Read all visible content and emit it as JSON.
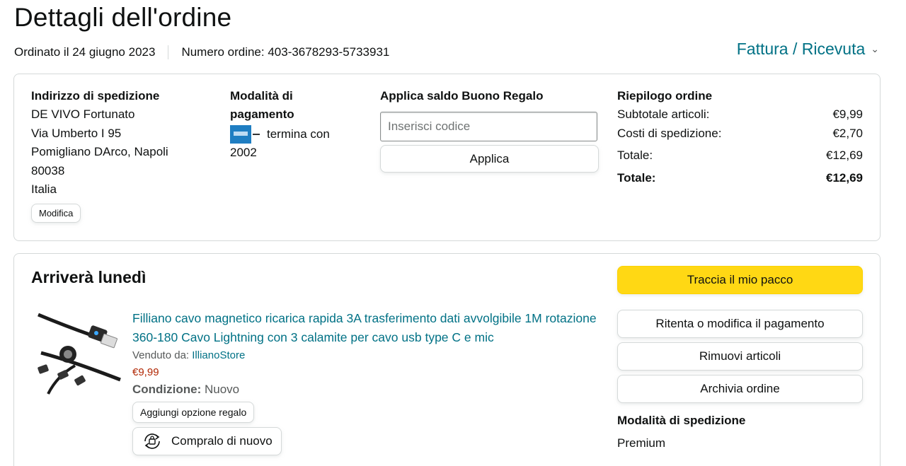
{
  "page": {
    "title": "Dettagli dell'ordine",
    "order_date": "Ordinato il 24 giugno 2023",
    "order_number": "Numero ordine: 403-3678293-5733931",
    "invoice_link": "Fattura / Ricevuta"
  },
  "shipping_address": {
    "title": "Indirizzo di spedizione",
    "name": "DE VIVO Fortunato",
    "street": "Via Umberto I 95",
    "city": "Pomigliano DArco, Napoli",
    "zip": "80038",
    "country": "Italia",
    "edit_label": "Modifica"
  },
  "payment": {
    "title": "Modalità di pagamento",
    "card_text": "termina con",
    "card_last": "2002",
    "card_icon": "amex-card-icon"
  },
  "gift": {
    "title": "Applica saldo Buono Regalo",
    "placeholder": "Inserisci codice",
    "apply_label": "Applica"
  },
  "summary": {
    "title": "Riepilogo ordine",
    "rows": [
      {
        "label": "Subtotale articoli:",
        "value": "€9,99"
      },
      {
        "label": "Costi di spedizione:",
        "value": "€2,70"
      },
      {
        "label": "Totale:",
        "value": "€12,69"
      },
      {
        "label": "Totale:",
        "value": "€12,69"
      }
    ]
  },
  "shipment": {
    "arrival": "Arriverà lunedì",
    "product_title": "Filliano cavo magnetico ricarica rapida 3A trasferimento dati avvolgibile 1M rotazione 360-180 Cavo Lightning con 3 calamite per cavo usb type C e mic",
    "sold_by_label": "Venduto da:",
    "seller": "IllianoStore",
    "price": "€9,99",
    "condition_label": "Condizione:",
    "condition_value": "Nuovo",
    "gift_option_label": "Aggiungi opzione regalo",
    "buy_again_label": "Compralo di nuovo"
  },
  "actions": {
    "track": "Traccia il mio pacco",
    "retry_payment": "Ritenta o modifica il pagamento",
    "remove_items": "Rimuovi articoli",
    "archive": "Archivia ordine",
    "shipping_method_title": "Modalità di spedizione",
    "shipping_method_value": "Premium"
  },
  "colors": {
    "link": "#007185",
    "price": "#b12704",
    "primary_button": "#ffd814",
    "border": "#d5d9d9"
  }
}
